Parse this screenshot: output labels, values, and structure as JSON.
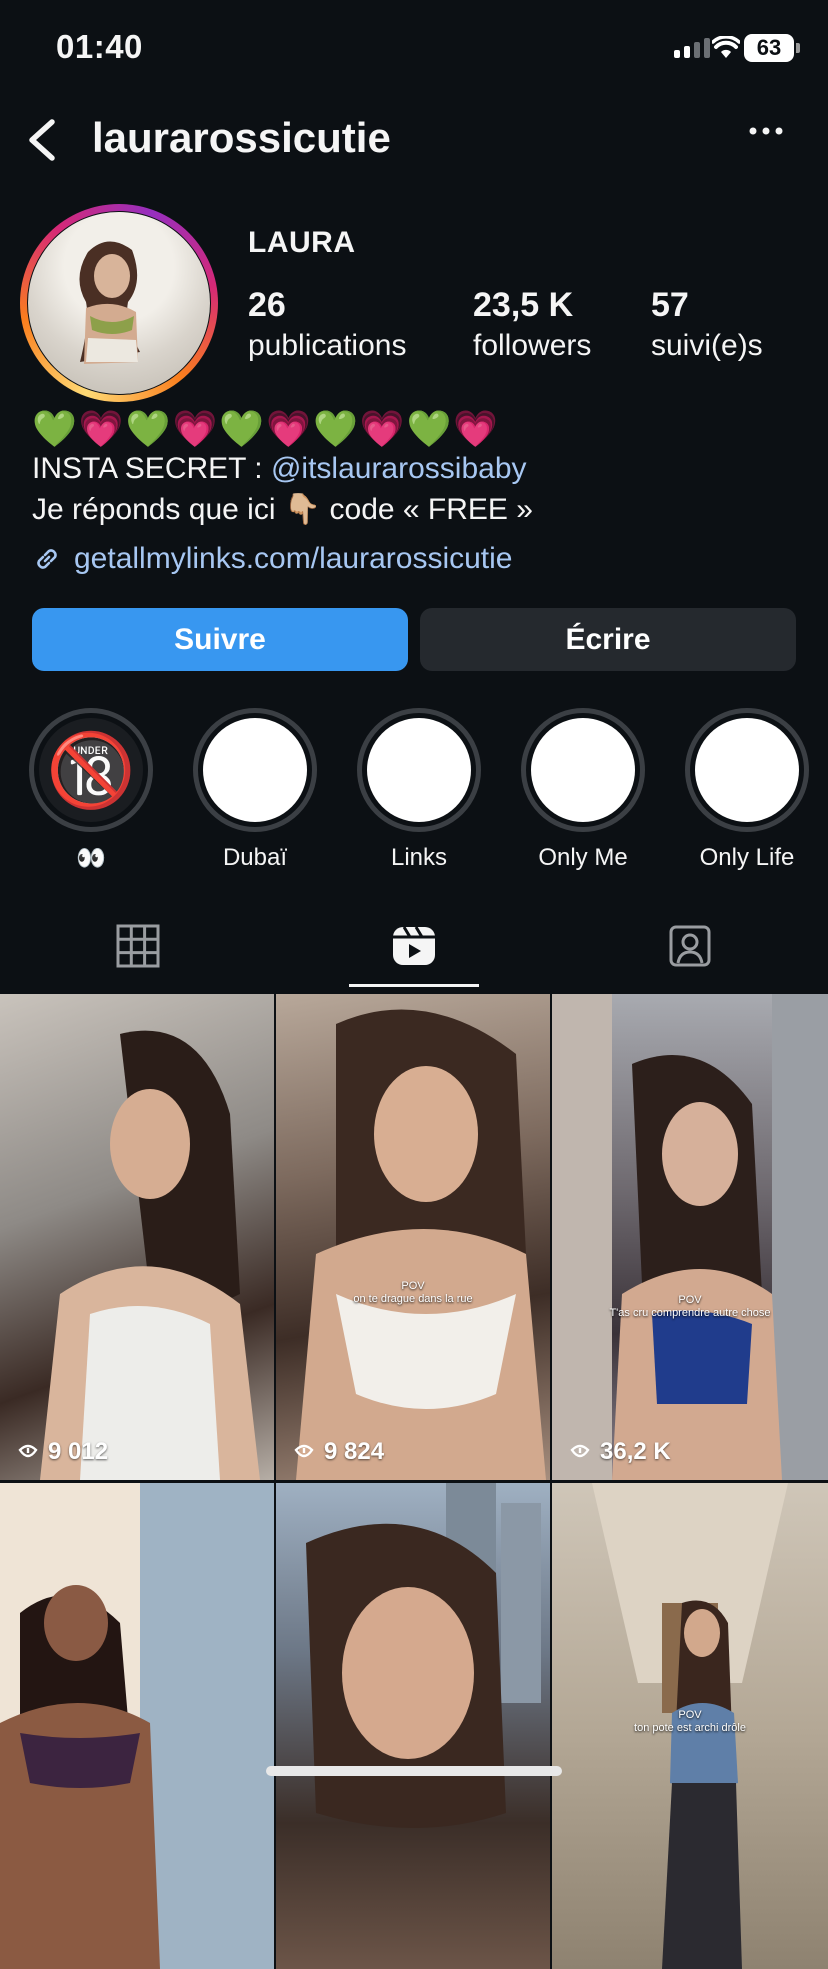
{
  "status_bar": {
    "time": "01:40",
    "battery": "63"
  },
  "header": {
    "username": "laurarossicutie"
  },
  "profile": {
    "name": "LAURA",
    "stats": [
      {
        "num": "26",
        "label": "publications"
      },
      {
        "num": "23,5 K",
        "label": "followers"
      },
      {
        "num": "57",
        "label": "suivi(e)s"
      }
    ]
  },
  "bio": {
    "hearts": "💚💗💚💗💚💗💚💗💚💗",
    "line1_prefix": "INSTA SECRET : ",
    "line1_mention": "@itslaurarossibaby",
    "line2": "Je réponds que ici 👇🏼 code « FREE »",
    "link": "getallmylinks.com/laurarossicutie"
  },
  "buttons": {
    "follow": "Suivre",
    "message": "Écrire"
  },
  "highlights": [
    {
      "label": "👀",
      "cover": "🔞"
    },
    {
      "label": "Dubaï"
    },
    {
      "label": "Links"
    },
    {
      "label": "Only Me"
    },
    {
      "label": "Only Life"
    }
  ],
  "tabs": [
    "grid-icon",
    "reels-icon",
    "tagged-icon"
  ],
  "reels": [
    {
      "views": "9 012",
      "caption": ""
    },
    {
      "views": "9 824",
      "caption": "POV\non te drague dans la rue"
    },
    {
      "views": "36,2 K",
      "caption": "POV\nT'as cru comprendre autre chose"
    },
    {
      "views": "",
      "caption": ""
    },
    {
      "views": "",
      "caption": ""
    },
    {
      "views": "",
      "caption": "POV\nton pote est archi drôle"
    }
  ],
  "colors": {
    "background": "#0c1014",
    "accent": "#3897f0",
    "link": "#a7c7f2"
  }
}
